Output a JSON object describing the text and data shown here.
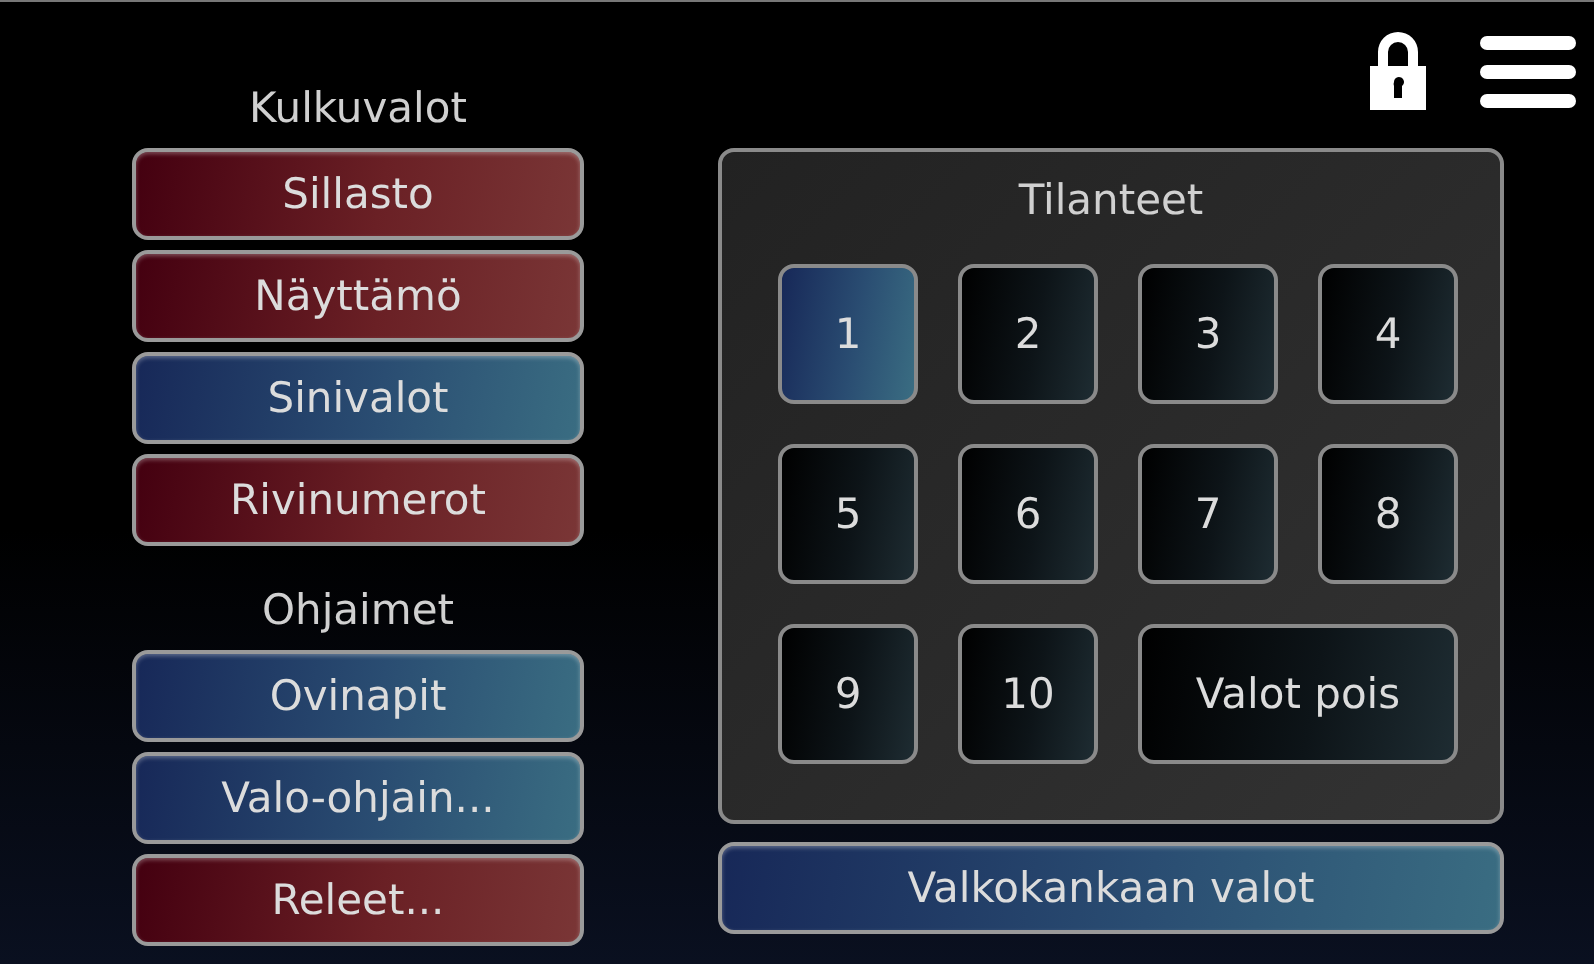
{
  "groups": [
    {
      "title": "Kulkuvalot",
      "buttons": [
        {
          "label": "Sillasto",
          "on": false
        },
        {
          "label": "Näyttämö",
          "on": false
        },
        {
          "label": "Sinivalot",
          "on": true
        },
        {
          "label": "Rivinumerot",
          "on": false
        }
      ]
    },
    {
      "title": "Ohjaimet",
      "buttons": [
        {
          "label": "Ovinapit",
          "on": true
        },
        {
          "label": "Valo-ohjain...",
          "on": true
        },
        {
          "label": "Releet...",
          "on": false
        }
      ]
    }
  ],
  "scenes": {
    "title": "Tilanteet",
    "items": [
      {
        "label": "1",
        "selected": true
      },
      {
        "label": "2",
        "selected": false
      },
      {
        "label": "3",
        "selected": false
      },
      {
        "label": "4",
        "selected": false
      },
      {
        "label": "5",
        "selected": false
      },
      {
        "label": "6",
        "selected": false
      },
      {
        "label": "7",
        "selected": false
      },
      {
        "label": "8",
        "selected": false
      },
      {
        "label": "9",
        "selected": false
      },
      {
        "label": "10",
        "selected": false
      },
      {
        "label": "Valot pois",
        "selected": false
      }
    ]
  },
  "screen_lights": {
    "label": "Valkokankaan valot",
    "on": true
  }
}
